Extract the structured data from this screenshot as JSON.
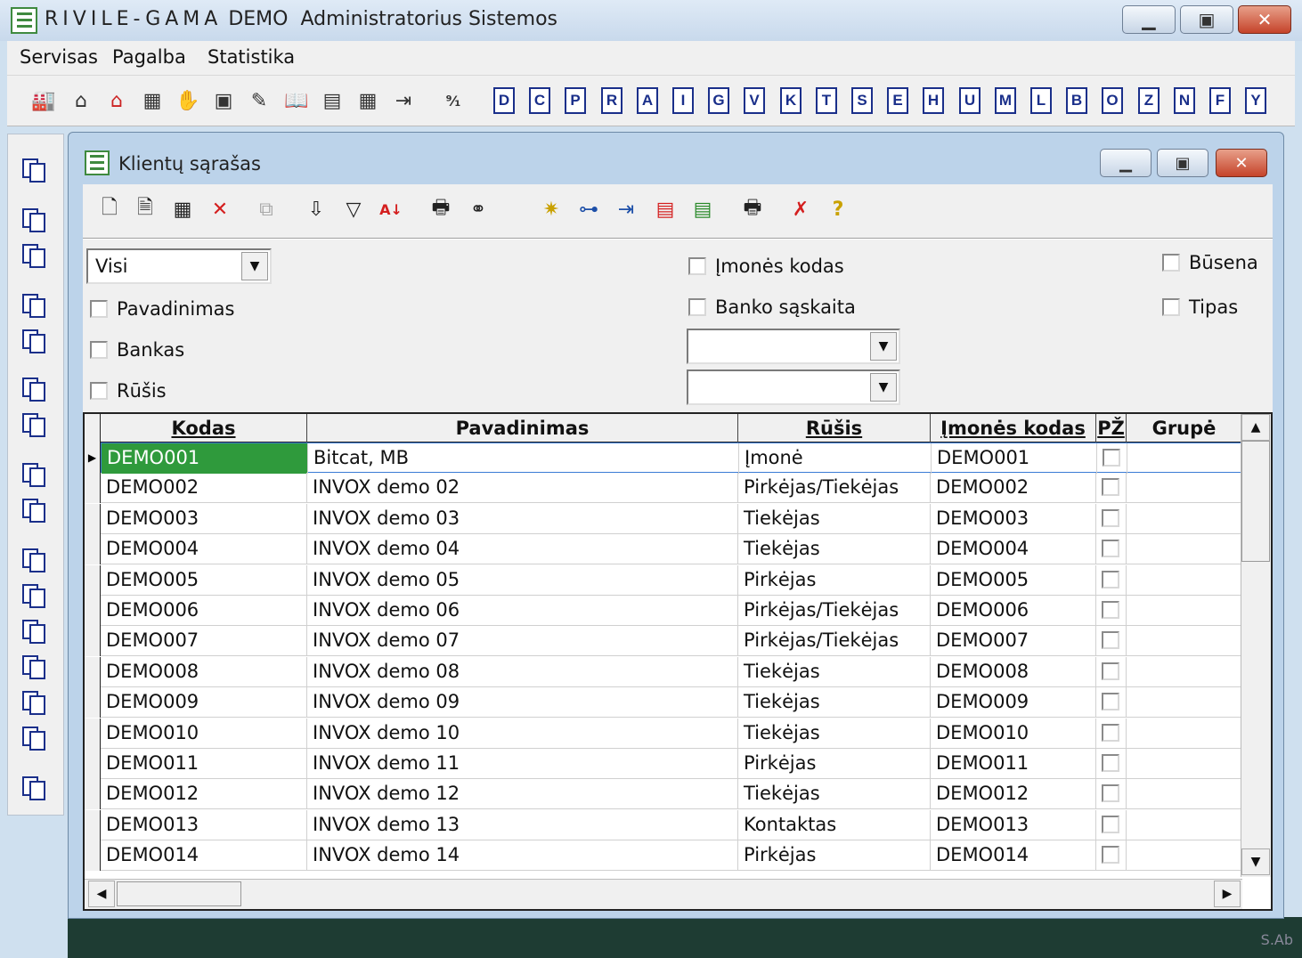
{
  "app": {
    "brand": "RIVILE-GAMA",
    "edition": "DEMO",
    "user": "Administratorius Sistemos"
  },
  "menu": [
    "Servisas",
    "Pagalba",
    "Statistika"
  ],
  "letter_buttons": [
    "D",
    "C",
    "P",
    "R",
    "A",
    "I",
    "G",
    "V",
    "K",
    "T",
    "S",
    "E",
    "H",
    "U",
    "M",
    "L",
    "B",
    "O",
    "Z",
    "N",
    "F",
    "Y"
  ],
  "child": {
    "title": "Klientų sąrašas"
  },
  "filters": {
    "combo_value": "Visi",
    "checkboxes": {
      "pavadinimas": "Pavadinimas",
      "bankas": "Bankas",
      "rusis": "Rūšis",
      "imones_kodas": "Įmonės kodas",
      "banko_saskaita": "Banko sąskaita",
      "busena": "Būsena",
      "tipas": "Tipas"
    }
  },
  "grid": {
    "columns": [
      "Kodas",
      "Pavadinimas",
      "Rūšis",
      "Įmonės kodas",
      "PŽ",
      "Grupė"
    ],
    "rows": [
      [
        "DEMO001",
        "Bitcat, MB",
        "Įmonė",
        "DEMO001"
      ],
      [
        "DEMO002",
        "INVOX demo 02",
        "Pirkėjas/Tiekėjas",
        "DEMO002"
      ],
      [
        "DEMO003",
        "INVOX demo 03",
        "Tiekėjas",
        "DEMO003"
      ],
      [
        "DEMO004",
        "INVOX demo 04",
        "Tiekėjas",
        "DEMO004"
      ],
      [
        "DEMO005",
        "INVOX demo 05",
        "Pirkėjas",
        "DEMO005"
      ],
      [
        "DEMO006",
        "INVOX demo 06",
        "Pirkėjas/Tiekėjas",
        "DEMO006"
      ],
      [
        "DEMO007",
        "INVOX demo 07",
        "Pirkėjas/Tiekėjas",
        "DEMO007"
      ],
      [
        "DEMO008",
        "INVOX demo 08",
        "Tiekėjas",
        "DEMO008"
      ],
      [
        "DEMO009",
        "INVOX demo 09",
        "Tiekėjas",
        "DEMO009"
      ],
      [
        "DEMO010",
        "INVOX demo 10",
        "Tiekėjas",
        "DEMO010"
      ],
      [
        "DEMO011",
        "INVOX demo 11",
        "Pirkėjas",
        "DEMO011"
      ],
      [
        "DEMO012",
        "INVOX demo 12",
        "Tiekėjas",
        "DEMO012"
      ],
      [
        "DEMO013",
        "INVOX demo 13",
        "Kontaktas",
        "DEMO013"
      ],
      [
        "DEMO014",
        "INVOX demo 14",
        "Pirkėjas",
        "DEMO014"
      ]
    ]
  },
  "footer": {
    "corner_text": "S.Ab"
  },
  "colors": {
    "selection": "#2f9a3c",
    "letter_icon": "#1a2f8a",
    "dark_bg": "#1e3c33"
  }
}
